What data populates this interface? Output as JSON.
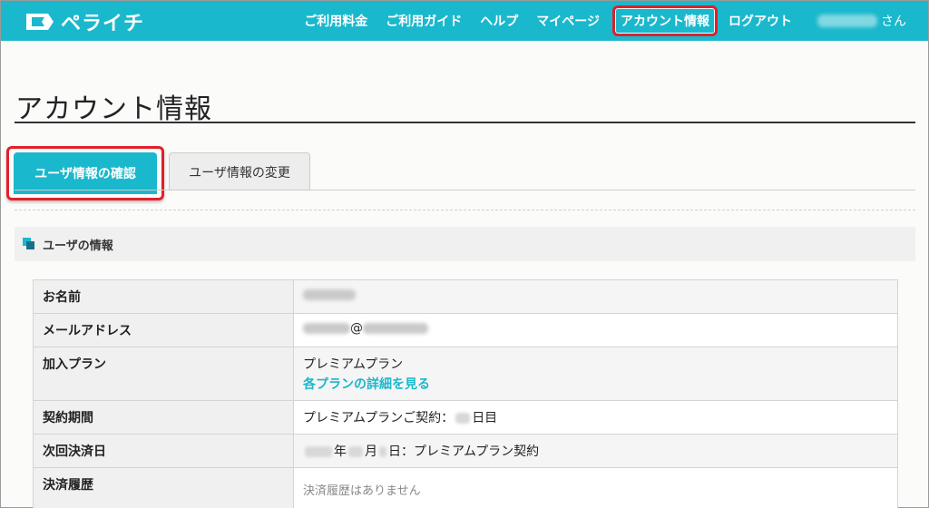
{
  "brand": {
    "name": "ペライチ",
    "accent": "#1ab8cc"
  },
  "nav": {
    "items": [
      "ご利用料金",
      "ご利用ガイド",
      "ヘルプ",
      "マイページ"
    ],
    "account": "アカウント情報",
    "logout": "ログアウト",
    "user_suffix": "さん"
  },
  "page": {
    "title": "アカウント情報"
  },
  "tabs": {
    "active": "ユーザ情報の確認",
    "inactive": "ユーザ情報の変更"
  },
  "section": {
    "title": "ユーザの情報"
  },
  "table": {
    "name_label": "お名前",
    "email_label": "メールアドレス",
    "email_at": "@",
    "plan_label": "加入プラン",
    "plan_value": "プレミアムプラン",
    "plan_link": "各プランの詳細を見る",
    "period_label": "契約期間",
    "period_prefix": "プレミアムプランご契約：",
    "period_suffix": "日目",
    "next_label": "次回決済日",
    "next_year": "年",
    "next_month": "月",
    "next_suffix": "日：プレミアムプラン契約",
    "history_label": "決済履歴",
    "history_value": "決済履歴はありません"
  }
}
